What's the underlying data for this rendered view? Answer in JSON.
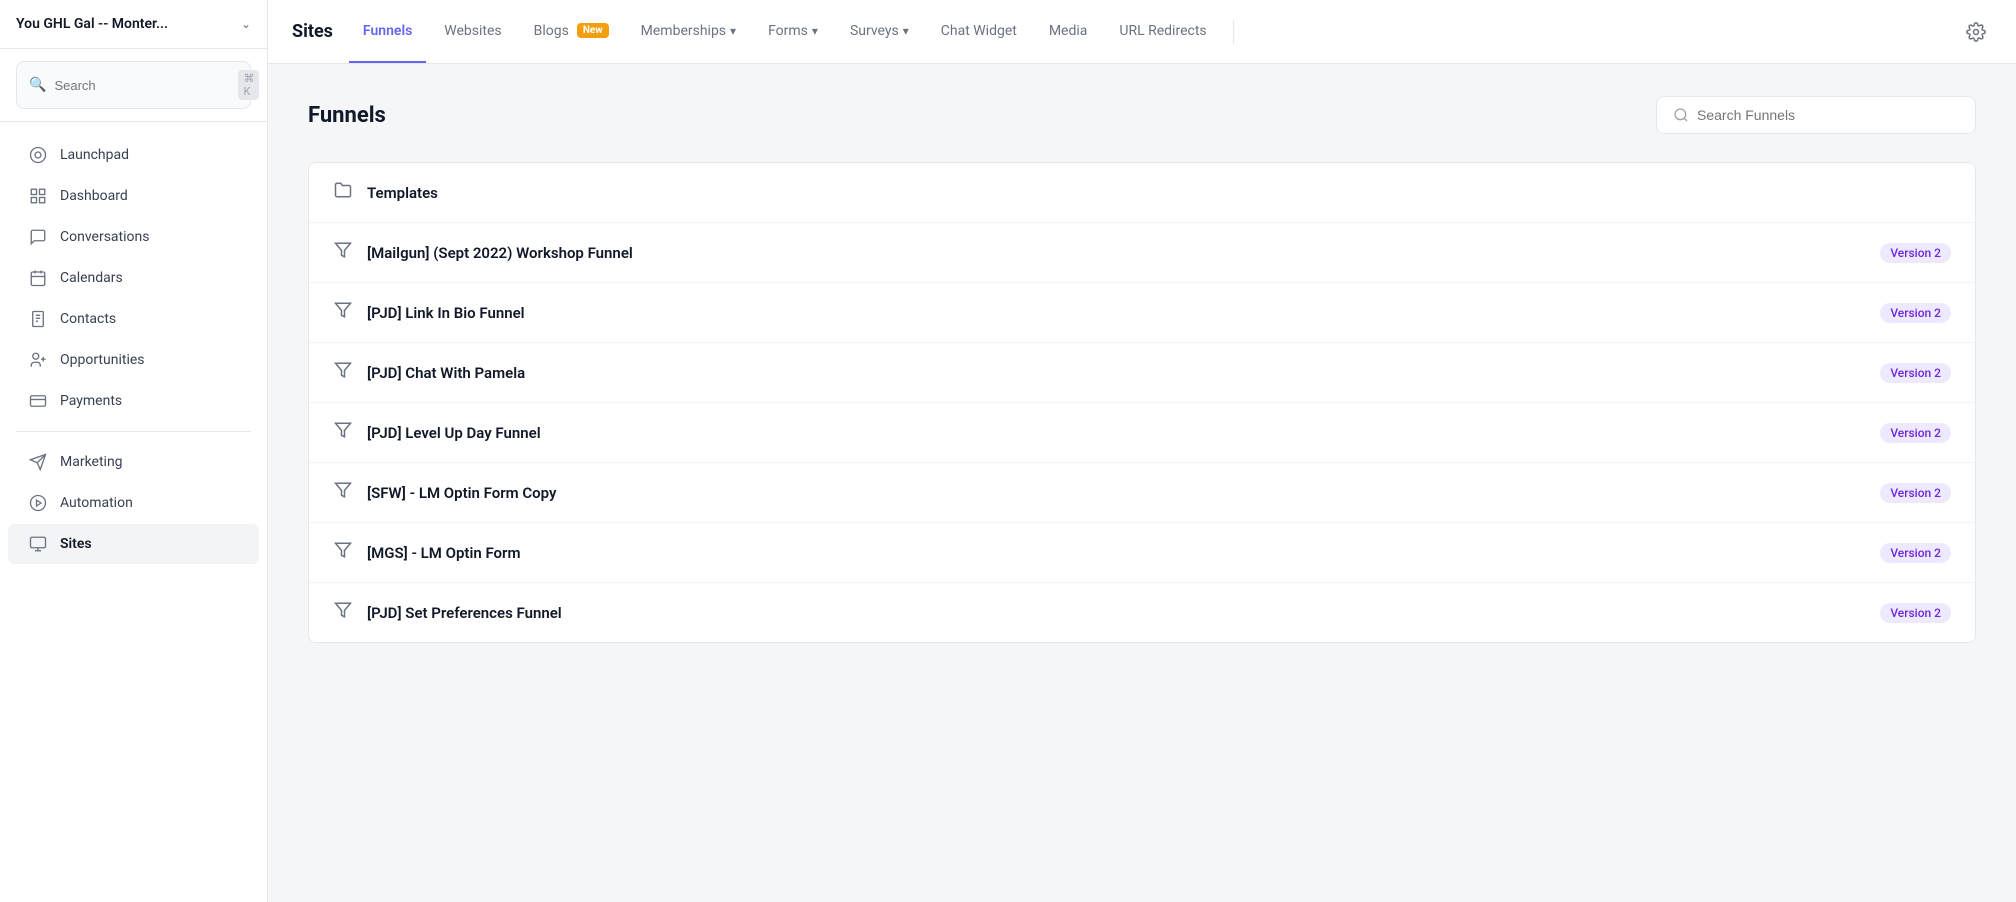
{
  "sidebar": {
    "account_name": "You GHL Gal -- Monter...",
    "search_placeholder": "Search",
    "search_shortcut": "⌘ K",
    "nav_items": [
      {
        "id": "launchpad",
        "label": "Launchpad",
        "icon": "🚀"
      },
      {
        "id": "dashboard",
        "label": "Dashboard",
        "icon": "⊞"
      },
      {
        "id": "conversations",
        "label": "Conversations",
        "icon": "💬"
      },
      {
        "id": "calendars",
        "label": "Calendars",
        "icon": "📅"
      },
      {
        "id": "contacts",
        "label": "Contacts",
        "icon": "📋"
      },
      {
        "id": "opportunities",
        "label": "Opportunities",
        "icon": "👥"
      },
      {
        "id": "payments",
        "label": "Payments",
        "icon": "🧾"
      },
      {
        "id": "marketing",
        "label": "Marketing",
        "icon": "✉️"
      },
      {
        "id": "automation",
        "label": "Automation",
        "icon": "▶"
      },
      {
        "id": "sites",
        "label": "Sites",
        "icon": "🖥"
      }
    ]
  },
  "topnav": {
    "brand": "Sites",
    "items": [
      {
        "id": "funnels",
        "label": "Funnels",
        "active": true,
        "badge": null,
        "has_dropdown": false
      },
      {
        "id": "websites",
        "label": "Websites",
        "active": false,
        "badge": null,
        "has_dropdown": false
      },
      {
        "id": "blogs",
        "label": "Blogs",
        "active": false,
        "badge": "New",
        "has_dropdown": false
      },
      {
        "id": "memberships",
        "label": "Memberships",
        "active": false,
        "badge": null,
        "has_dropdown": true
      },
      {
        "id": "forms",
        "label": "Forms",
        "active": false,
        "badge": null,
        "has_dropdown": true
      },
      {
        "id": "surveys",
        "label": "Surveys",
        "active": false,
        "badge": null,
        "has_dropdown": true
      },
      {
        "id": "chat-widget",
        "label": "Chat Widget",
        "active": false,
        "badge": null,
        "has_dropdown": false
      },
      {
        "id": "media",
        "label": "Media",
        "active": false,
        "badge": null,
        "has_dropdown": false
      },
      {
        "id": "url-redirects",
        "label": "URL Redirects",
        "active": false,
        "badge": null,
        "has_dropdown": false
      }
    ]
  },
  "content": {
    "title": "Funnels",
    "search_placeholder": "Search Funnels",
    "funnels": [
      {
        "id": "templates",
        "name": "Templates",
        "icon": "folder",
        "version": null
      },
      {
        "id": "mailgun-workshop",
        "name": "[Mailgun] (Sept 2022) Workshop Funnel",
        "icon": "funnel",
        "version": "Version 2"
      },
      {
        "id": "pjd-link-bio",
        "name": "[PJD] Link In Bio Funnel",
        "icon": "funnel",
        "version": "Version 2"
      },
      {
        "id": "pjd-chat-pamela",
        "name": "[PJD] Chat With Pamela",
        "icon": "funnel",
        "version": "Version 2"
      },
      {
        "id": "pjd-level-up",
        "name": "[PJD] Level Up Day Funnel",
        "icon": "funnel",
        "version": "Version 2"
      },
      {
        "id": "sfw-lm-optin-copy",
        "name": "[SFW] - LM Optin Form Copy",
        "icon": "funnel",
        "version": "Version 2"
      },
      {
        "id": "mgs-lm-optin",
        "name": "[MGS] - LM Optin Form",
        "icon": "funnel",
        "version": "Version 2"
      },
      {
        "id": "pjd-set-preferences",
        "name": "[PJD] Set Preferences Funnel",
        "icon": "funnel",
        "version": "Version 2"
      }
    ]
  }
}
